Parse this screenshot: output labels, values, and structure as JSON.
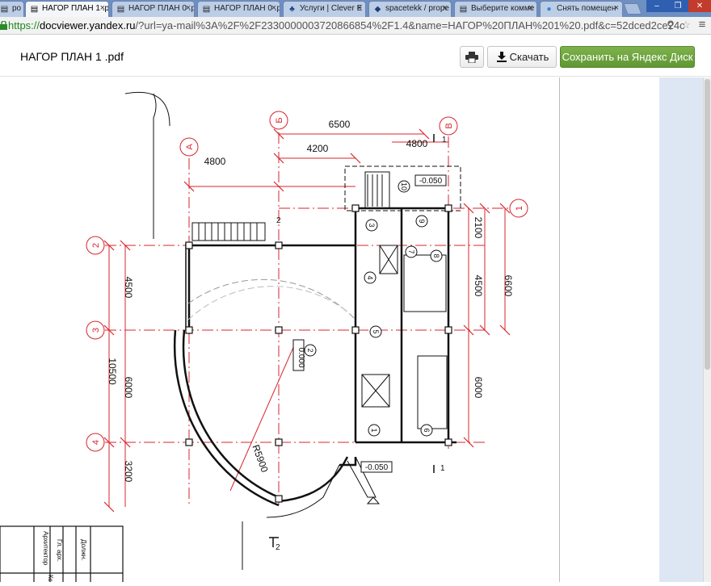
{
  "tabs": [
    {
      "title": "ро",
      "icon": "doc-icon",
      "active": false
    },
    {
      "title": "НАГОР ПЛАН 1 .p",
      "icon": "doc-icon",
      "active": true
    },
    {
      "title": "НАГОР ПЛАН 0 .p",
      "icon": "doc-icon",
      "active": false
    },
    {
      "title": "НАГОР ПЛАН 0 .p",
      "icon": "doc-icon",
      "active": false
    },
    {
      "title": "Услуги | Clever E",
      "icon": "leaf-icon",
      "active": false
    },
    {
      "title": "spacetekk / prope",
      "icon": "shield-icon",
      "active": false
    },
    {
      "title": "Выберите комме",
      "icon": "doc-icon",
      "active": false
    },
    {
      "title": "Снять помещен",
      "icon": "map-pin-icon",
      "active": false
    }
  ],
  "address": {
    "scheme": "https://",
    "host": "docviewer.yandex.ru",
    "path": "/?url=ya-mail%3A%2F%2F2330000003720866854%2F1.4&name=НАГОР%20ПЛАН%201%20.pdf&c=52dced2ce24c"
  },
  "viewer": {
    "title": "НАГОР ПЛАН 1 .pdf",
    "download_label": "Скачать",
    "save_label": "Сохранить на Яндекс Диск"
  },
  "colors": {
    "accent_green": "#6aa43a",
    "drawing_red": "#d9252c"
  },
  "drawing": {
    "axes": [
      "А",
      "Б",
      "В",
      "1",
      "2",
      "3",
      "4"
    ],
    "dims": [
      "6500",
      "4200",
      "4800",
      "4800",
      "2100",
      "4500",
      "6600",
      "4500",
      "10500",
      "6000",
      "6000",
      "3200",
      "R5900"
    ],
    "level_top": "-0.050",
    "level_main": "0.000",
    "level_bottom": "-0.050",
    "rooms": [
      "10",
      "9",
      "3",
      "7",
      "8",
      "4",
      "2",
      "6",
      "1",
      "5"
    ],
    "section_marks": [
      "1",
      "1",
      "2",
      "2"
    ],
    "stamp": [
      "Гл. арх.",
      "Архитектор",
      "Должн.",
      "Кс"
    ]
  }
}
